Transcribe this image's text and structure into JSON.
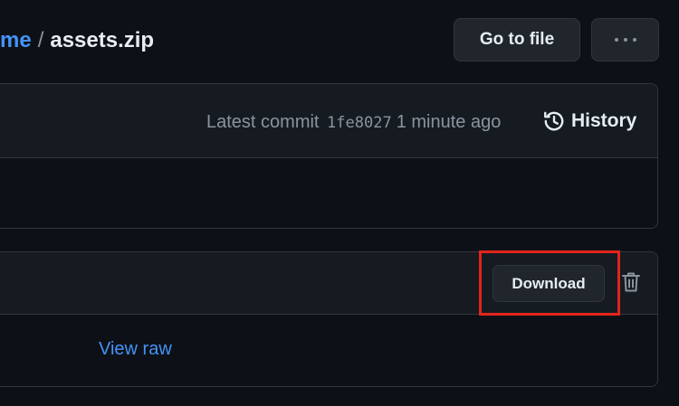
{
  "breadcrumb": {
    "parent_partial": "me",
    "separator": "/",
    "file_name": "assets.zip"
  },
  "header_actions": {
    "go_to_file_label": "Go to file",
    "more_icon": "kebab-horizontal-icon"
  },
  "commit": {
    "prefix": "Latest commit",
    "sha": "1fe8027",
    "time": "1 minute ago",
    "history_label": "History",
    "history_icon": "history-icon"
  },
  "file": {
    "download_label": "Download",
    "delete_icon": "trash-icon",
    "view_raw_label": "View raw"
  },
  "colors": {
    "background": "#0d1117",
    "header_background": "#161b22",
    "border": "#30363d",
    "link": "#4493f8",
    "muted_text": "#8b949e",
    "highlight": "#e3241b"
  }
}
